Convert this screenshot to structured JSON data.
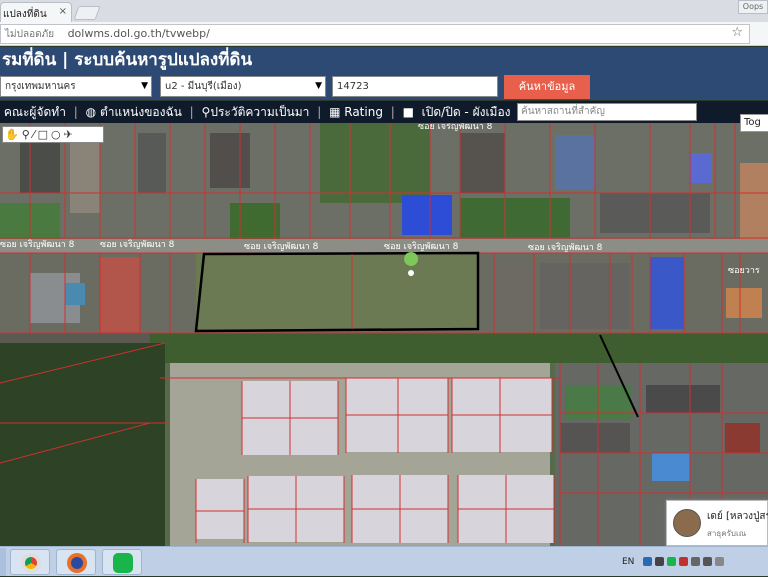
{
  "browser": {
    "tab_title": "แปลงที่ดิน",
    "tab_close": "×",
    "window_user": "Oops",
    "insecure_label": "ไม่ปลอดภัย",
    "url": "dolwms.dol.go.th/tvwebp/",
    "star": "☆",
    "menu": "⋮"
  },
  "header": {
    "title": "รมที่ดิน | ระบบค้นหารูปแปลงที่ดิน"
  },
  "search": {
    "province": "กรุงเทพมหานคร",
    "district": "u2 - มีนบุรี(เมือง)",
    "parcel_number": "14723",
    "search_button": "ค้นหาข้อมูล"
  },
  "toolbar": {
    "staff": "คณะผู้จัดทำ",
    "my_location": "ตำแหน่งของฉัน",
    "history": "ประวัติความเป็นมา",
    "rating": "Rating",
    "toggle_layer": "เปิด/ปิด - ผังเมือง",
    "place_search_placeholder": "ค้นหาสถานที่สำคัญ",
    "toggle_button": "Tog"
  },
  "draw_tools": {
    "icons": [
      "hand-icon",
      "pin-icon",
      "line-icon",
      "square-icon",
      "circle-icon",
      "bird-icon"
    ]
  },
  "map": {
    "road_labels": [
      "ซอย เจริญพัฒนา 8",
      "ซอย เจริญพัฒนา 8",
      "ซอย เจริญพัฒนา 8",
      "ซอย เจริญพัฒนา 8",
      "ซอย เจริญพัฒนา 8"
    ],
    "top_label": "ซอย เจริญพัฒนา 8",
    "right_label": "ซอยวาร"
  },
  "notification": {
    "name": "เดย์ [หลวงปู่สรา",
    "subtitle": "สาธุครับเณ"
  },
  "taskbar": {
    "lang": "EN"
  },
  "colors": {
    "header_bg": "#2c4a73",
    "search_button": "#e8604c",
    "parcel_outline": "#d03030"
  }
}
